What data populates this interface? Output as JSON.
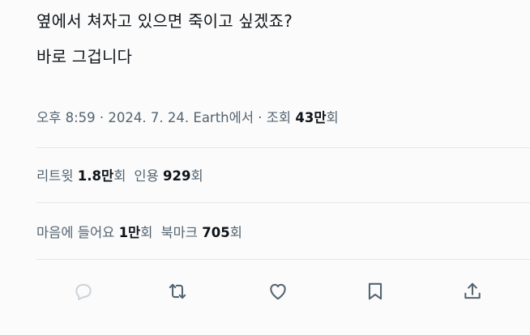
{
  "tweet": {
    "line1": "옆에서 쳐자고 있으면 죽이고 싶겠죠?",
    "line2": "바로 그겁니다"
  },
  "meta": {
    "time": "오후 8:59",
    "sep1": " · ",
    "date": "2024. 7. 24.",
    "sep2": " ",
    "source": "Earth에서",
    "sep3": " · ",
    "views_label": "조회 ",
    "views_value": "43만",
    "views_suffix": "회"
  },
  "stats": {
    "retweets_label": "리트윗 ",
    "retweets_value": "1.8만",
    "retweets_suffix": "회",
    "quotes_label": "인용 ",
    "quotes_value": "929",
    "quotes_suffix": "회",
    "likes_label": "마음에 들어요 ",
    "likes_value": "1만",
    "likes_suffix": "회",
    "bookmarks_label": "북마크 ",
    "bookmarks_value": "705",
    "bookmarks_suffix": "회"
  },
  "actions": [
    "reply-icon",
    "retweet-icon",
    "like-icon",
    "bookmark-icon",
    "share-icon"
  ],
  "colors": {
    "text": "#0f1419",
    "secondary": "#536471",
    "divider": "#e3e6e9",
    "background": "#fbfbfb"
  }
}
